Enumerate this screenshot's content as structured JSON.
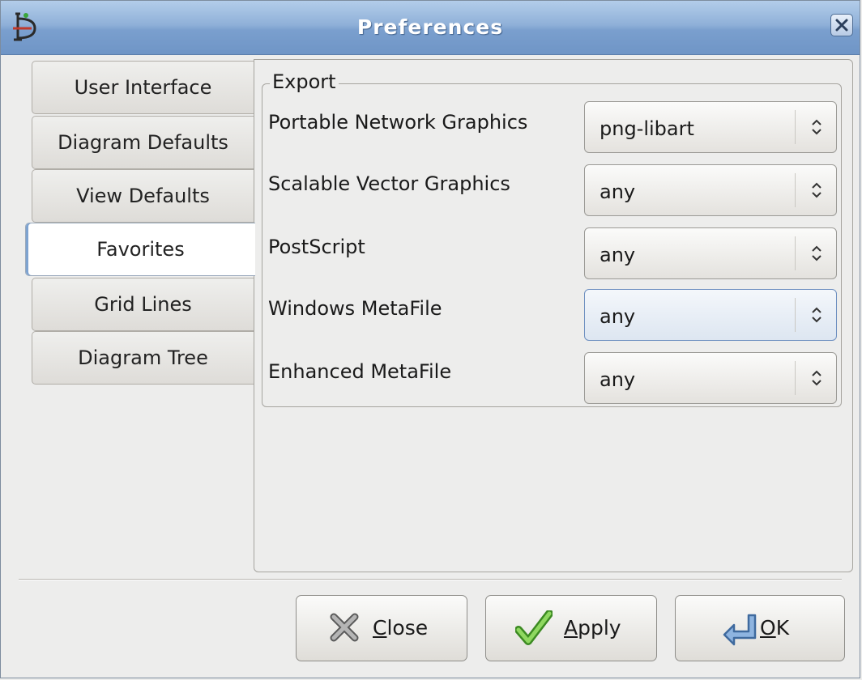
{
  "window": {
    "title": "Preferences"
  },
  "tabs": [
    {
      "label": "User Interface"
    },
    {
      "label": "Diagram Defaults"
    },
    {
      "label": "View Defaults"
    },
    {
      "label": "Favorites"
    },
    {
      "label": "Grid Lines"
    },
    {
      "label": "Diagram Tree"
    }
  ],
  "active_tab": "Favorites",
  "export": {
    "label": "Export",
    "rows": [
      {
        "label": "Portable Network Graphics",
        "value": "png-libart"
      },
      {
        "label": "Scalable Vector Graphics",
        "value": "any"
      },
      {
        "label": "PostScript",
        "value": "any"
      },
      {
        "label": "Windows MetaFile",
        "value": "any"
      },
      {
        "label": "Enhanced MetaFile",
        "value": "any"
      }
    ]
  },
  "buttons": {
    "close": {
      "mnemonic": "C",
      "rest": "lose"
    },
    "apply": {
      "mnemonic": "A",
      "rest": "pply"
    },
    "ok": {
      "mnemonic": "O",
      "rest": "K"
    }
  },
  "icons": [
    "dia-app-icon",
    "window-close-icon",
    "combo-arrows-icon",
    "close-x-icon",
    "apply-check-icon",
    "ok-enter-arrow-icon"
  ]
}
